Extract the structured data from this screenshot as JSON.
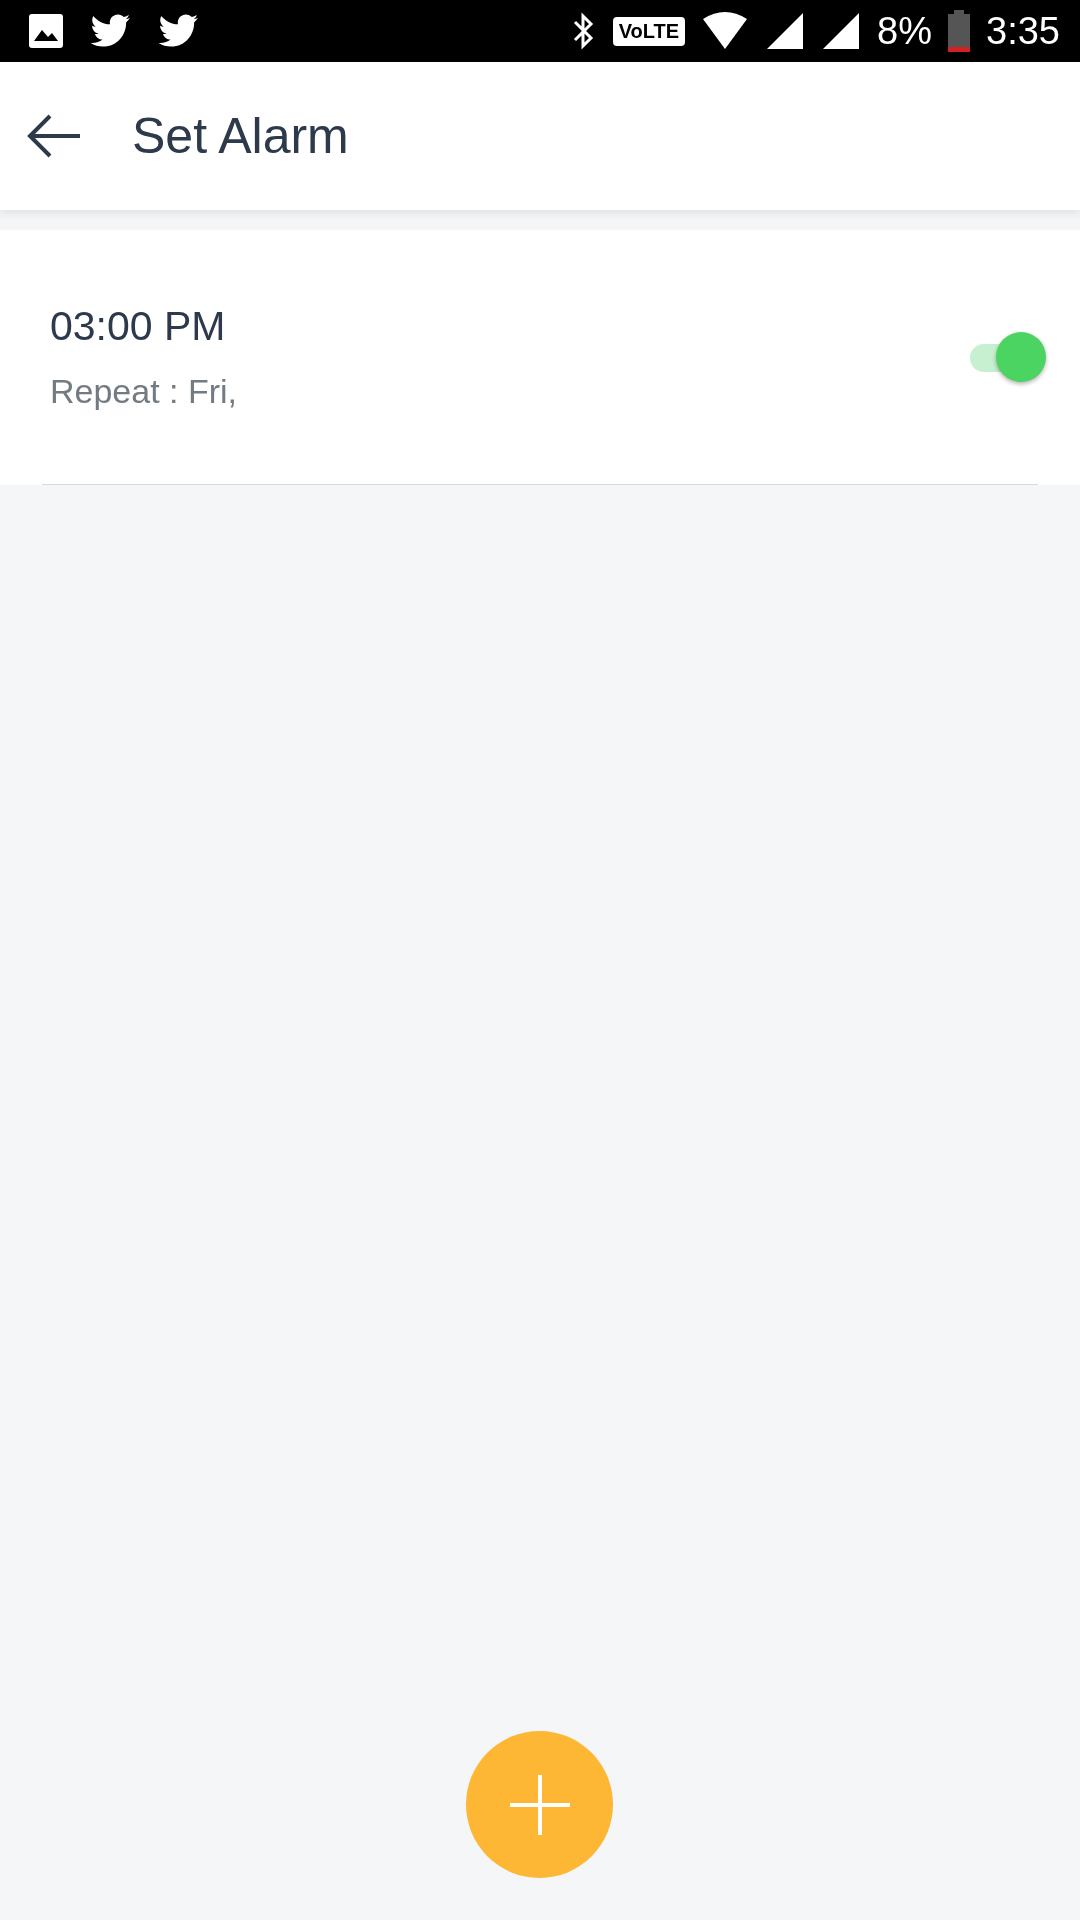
{
  "status_bar": {
    "volte": "VoLTE",
    "battery_percent": "8%",
    "time": "3:35"
  },
  "app_bar": {
    "title": "Set Alarm"
  },
  "alarms": [
    {
      "time": "03:00 PM",
      "repeat": "Repeat : Fri,",
      "on": true
    }
  ]
}
